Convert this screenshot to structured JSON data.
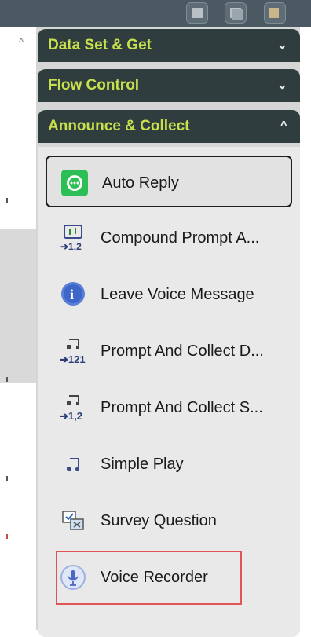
{
  "sections": [
    {
      "title": "Data Set & Get",
      "chevron": "⌄"
    },
    {
      "title": "Flow Control",
      "chevron": "⌄"
    },
    {
      "title": "Announce & Collect",
      "chevron": "^"
    }
  ],
  "items": [
    {
      "label": "Auto Reply",
      "icon": "chat-bubble-icon"
    },
    {
      "label": "Compound Prompt A...",
      "icon": "compound-prompt-icon"
    },
    {
      "label": "Leave Voice Message",
      "icon": "info-icon"
    },
    {
      "label": "Prompt And Collect D...",
      "icon": "prompt-collect-digits-icon"
    },
    {
      "label": "Prompt And Collect S...",
      "icon": "prompt-collect-speech-icon"
    },
    {
      "label": "Simple Play",
      "icon": "music-note-icon"
    },
    {
      "label": "Survey Question",
      "icon": "survey-icon"
    },
    {
      "label": "Voice Recorder",
      "icon": "microphone-icon"
    }
  ],
  "colors": {
    "header_bg": "#2f3d3f",
    "header_text": "#c8e04b",
    "highlight": "#e15454"
  }
}
